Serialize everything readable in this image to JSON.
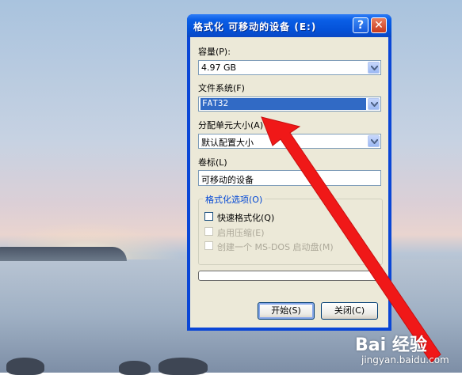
{
  "dialog": {
    "title": "格式化 可移动的设备 (E:)",
    "help_glyph": "?",
    "close_glyph": "✕"
  },
  "capacity": {
    "label": "容量(P):",
    "value": "4.97 GB"
  },
  "file_system": {
    "label": "文件系统(F)",
    "value": "FAT32"
  },
  "allocation": {
    "label": "分配单元大小(A)",
    "value": "默认配置大小"
  },
  "volume": {
    "label": "卷标(L)",
    "value": "可移动的设备"
  },
  "format_options": {
    "title": "格式化选项(O)",
    "quick_format": {
      "label": "快速格式化(Q)",
      "checked": false,
      "enabled": true
    },
    "compression": {
      "label": "启用压缩(E)",
      "checked": false,
      "enabled": false
    },
    "msdos_disk": {
      "label": "创建一个 MS-DOS 启动盘(M)",
      "checked": false,
      "enabled": false
    }
  },
  "progress": {
    "value": 0
  },
  "buttons": {
    "start": "开始(S)",
    "close": "关闭(C)"
  },
  "watermark": {
    "brand": "Bai 经验",
    "url": "jingyan.baidu.com"
  },
  "colors": {
    "titlebar": "#0451d8",
    "selection": "#316ac5",
    "annotation_arrow": "#f01818"
  }
}
